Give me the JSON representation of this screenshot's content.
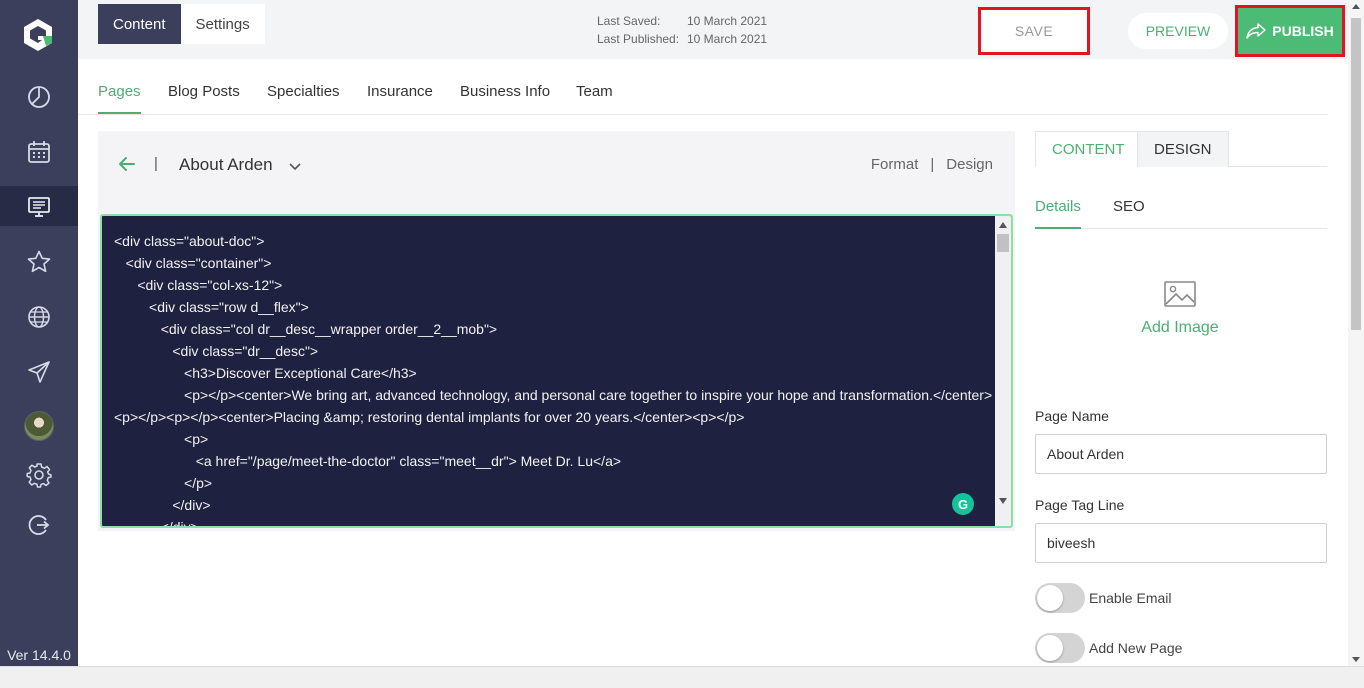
{
  "sidebar": {
    "version": "Ver 14.4.0",
    "accent": "#4cbb75",
    "items": [
      {
        "icon": "dashboard-icon"
      },
      {
        "icon": "calendar-icon"
      },
      {
        "icon": "website-editor-icon"
      },
      {
        "icon": "star-icon"
      },
      {
        "icon": "globe-icon"
      },
      {
        "icon": "send-icon"
      },
      {
        "icon": "avatar"
      },
      {
        "icon": "gear-icon"
      },
      {
        "icon": "logout-icon"
      }
    ]
  },
  "topbar": {
    "tabs": [
      {
        "label": "Content"
      },
      {
        "label": "Settings"
      }
    ],
    "last_saved_label": "Last Saved:",
    "last_saved_value": "10 March 2021",
    "last_published_label": "Last Published:",
    "last_published_value": "10 March 2021",
    "save_label": "SAVE",
    "preview_label": "PREVIEW",
    "publish_label": "PUBLISH"
  },
  "nav": {
    "tabs": [
      {
        "label": "Pages"
      },
      {
        "label": "Blog Posts"
      },
      {
        "label": "Specialties"
      },
      {
        "label": "Insurance"
      },
      {
        "label": "Business Info"
      },
      {
        "label": "Team"
      }
    ]
  },
  "editor": {
    "separator": "|",
    "page_title": "About Arden",
    "format_label": "Format",
    "design_label": "Design",
    "code": "<div class=\"about-doc\">\n   <div class=\"container\">\n      <div class=\"col-xs-12\">\n         <div class=\"row d__flex\">\n            <div class=\"col dr__desc__wrapper order__2__mob\">\n               <div class=\"dr__desc\">\n                  <h3>Discover Exceptional Care</h3>\n                  <p></p><center>We bring art, advanced technology, and personal care together to inspire your hope and transformation.</center><p></p><p></p><center>Placing &amp; restoring dental implants for over 20 years.</center><p></p>\n                  <p>\n                     <a href=\"/page/meet-the-doctor\" class=\"meet__dr\"> Meet Dr. Lu</a>\n                  </p>\n               </div>\n            </div>",
    "grammarly_label": "G"
  },
  "right_panel": {
    "tabs": [
      {
        "label": "CONTENT"
      },
      {
        "label": "DESIGN"
      }
    ],
    "sub_tabs": [
      {
        "label": "Details"
      },
      {
        "label": "SEO"
      }
    ],
    "add_image_label": "Add Image",
    "page_name_label": "Page Name",
    "page_name_value": "About Arden",
    "page_tag_line_label": "Page Tag Line",
    "page_tag_line_value": "biveesh",
    "enable_email_label": "Enable Email",
    "add_new_page_label": "Add New Page"
  }
}
